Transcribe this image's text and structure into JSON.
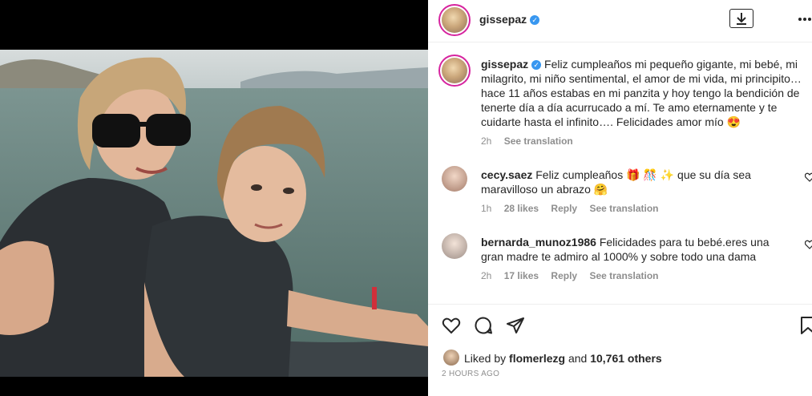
{
  "post": {
    "username": "gissepaz",
    "verified_mark": "✓",
    "more_icon": "more-horizontal-icon",
    "download_icon": "download-icon"
  },
  "caption": {
    "username": "gissepaz",
    "text": "Feliz cumpleaños mi pequeño gigante, mi bebé, mi milagrito, mi niño sentimental, el amor de mi vida, mi principito… hace 11 años estabas en mi panzita y hoy tengo la bendición de tenerte día a día acurrucado a mí. Te amo eternamente y te cuidarte hasta el infinito…. Felicidades amor mío 😍",
    "time": "2h",
    "see_translation": "See translation"
  },
  "comments": [
    {
      "username": "cecy.saez",
      "text": "Feliz cumpleaños 🎁 🎊 ✨ que su día sea maravilloso un abrazo 🤗",
      "time": "1h",
      "likes": "28 likes",
      "reply": "Reply",
      "see_translation": "See translation"
    },
    {
      "username": "bernarda_munoz1986",
      "text": "Felicidades para tu bebé.eres una gran madre te admiro al 1000% y sobre todo una dama",
      "time": "2h",
      "likes": "17 likes",
      "reply": "Reply",
      "see_translation": "See translation"
    }
  ],
  "actions": {
    "like_icon": "heart-icon",
    "comment_icon": "comment-icon",
    "share_icon": "share-icon",
    "save_icon": "bookmark-icon"
  },
  "likes": {
    "prefix": "Liked by",
    "user": "flomerlezg",
    "and": "and",
    "count": "10,761 others"
  },
  "timestamp": "2 HOURS AGO",
  "colors": {
    "verified": "#3897f0",
    "text": "#262626",
    "muted": "#8e8e8e",
    "story_ring": "#d6249f"
  }
}
